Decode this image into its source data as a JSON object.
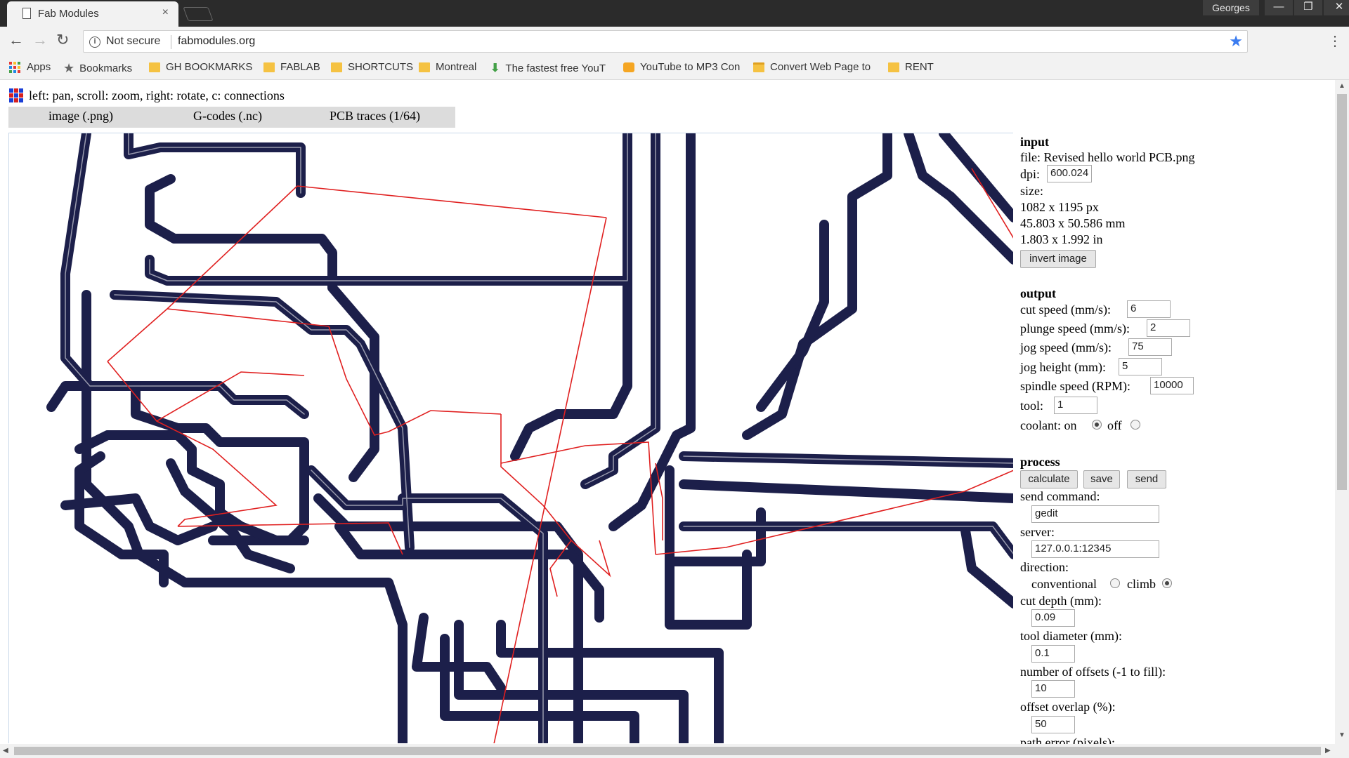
{
  "browser": {
    "tab_title": "Fab Modules",
    "tab_close": "×",
    "profile_name": "Georges",
    "window_buttons": [
      "—",
      "❐",
      "✕"
    ],
    "not_secure_label": "Not secure",
    "url": "fabmodules.org"
  },
  "bookmarks": [
    {
      "label": "Apps",
      "icon": "apps-icon"
    },
    {
      "label": "Bookmarks",
      "icon": "star-icon"
    },
    {
      "label": "GH BOOKMARKS",
      "icon": "folder-icon"
    },
    {
      "label": "FABLAB",
      "icon": "folder-icon"
    },
    {
      "label": "SHORTCUTS",
      "icon": "folder-icon"
    },
    {
      "label": "Montreal",
      "icon": "folder-icon"
    },
    {
      "label": "The fastest free YouT",
      "icon": "download-arrow-icon"
    },
    {
      "label": "YouTube to MP3 Con",
      "icon": "camera-icon"
    },
    {
      "label": "Convert Web Page to",
      "icon": "folder-open-icon"
    },
    {
      "label": "RENT",
      "icon": "folder-icon"
    }
  ],
  "page": {
    "help_text": "left: pan, scroll: zoom, right: rotate, c: connections",
    "modes": [
      "image (.png)",
      "G-codes (.nc)",
      "PCB traces (1/64)"
    ]
  },
  "input": {
    "title": "input",
    "file_label": "file:",
    "file_name": "Revised hello world PCB.png",
    "dpi_label": "dpi:",
    "dpi_value": "600.024",
    "size_label": "size:",
    "size_px": "1082 x 1195 px",
    "size_mm": "45.803 x 50.586 mm",
    "size_in": "1.803 x 1.992 in",
    "invert_button": "invert image"
  },
  "output": {
    "title": "output",
    "cut_speed_label": "cut speed (mm/s):",
    "cut_speed": "6",
    "plunge_speed_label": "plunge speed (mm/s):",
    "plunge_speed": "2",
    "jog_speed_label": "jog speed (mm/s):",
    "jog_speed": "75",
    "jog_height_label": "jog height (mm):",
    "jog_height": "5",
    "spindle_speed_label": "spindle speed (RPM):",
    "spindle_speed": "10000",
    "tool_label": "tool:",
    "tool": "1",
    "coolant_label": "coolant: on",
    "coolant_off_label": "off",
    "coolant_on": true
  },
  "process": {
    "title": "process",
    "calculate_button": "calculate",
    "save_button": "save",
    "send_button": "send",
    "send_command_label": "send command:",
    "send_command": "gedit",
    "server_label": "server:",
    "server": "127.0.0.1:12345",
    "direction_label": "direction:",
    "conventional_label": "conventional",
    "climb_label": "climb",
    "direction_selected": "climb",
    "cut_depth_label": "cut depth (mm):",
    "cut_depth": "0.09",
    "tool_diameter_label": "tool diameter (mm):",
    "tool_diameter": "0.1",
    "offsets_label": "number of offsets (-1 to fill):",
    "offsets": "10",
    "overlap_label": "offset overlap (%):",
    "overlap": "50",
    "path_error_label": "path error (pixels):"
  },
  "colors": {
    "trace": "#1c1f4a",
    "connection": "#e02020",
    "chrome_dark": "#2b2b2b",
    "chrome_light": "#f2f2f2",
    "accent_blue": "#3b7cf0",
    "folder": "#f5c242"
  }
}
